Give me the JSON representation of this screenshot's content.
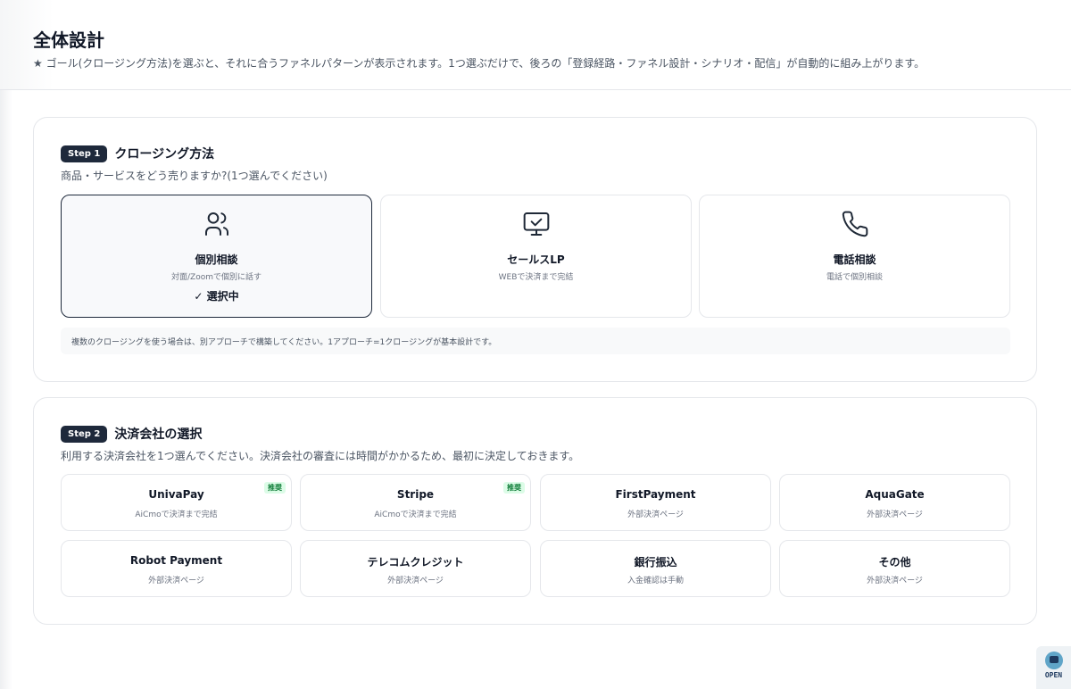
{
  "header": {
    "title": "全体設計",
    "subtitle": "★ ゴール(クロージング方法)を選ぶと、それに合うファネルパターンが表示されます。1つ選ぶだけで、後ろの「登録経路・ファネル設計・シナリオ・配信」が自動的に組み上がります。"
  },
  "step1": {
    "badge": "Step 1",
    "title": "クロージング方法",
    "description": "商品・サービスをどう売りますか?(1つ選んでください)",
    "options": [
      {
        "name": "個別相談",
        "sub": "対面/Zoomで個別に話す",
        "status": "✓ 選択中",
        "icon": "users-icon",
        "selected": true
      },
      {
        "name": "セールスLP",
        "sub": "WEBで決済まで完結",
        "icon": "monitor-check-icon"
      },
      {
        "name": "電話相談",
        "sub": "電話で個別相談",
        "icon": "phone-icon"
      }
    ],
    "note": "複数のクロージングを使う場合は、別アプローチで構築してください。1アプローチ=1クロージングが基本設計です。"
  },
  "step2": {
    "badge": "Step 2",
    "title": "決済会社の選択",
    "description": "利用する決済会社を1つ選んでください。決済会社の審査には時間がかかるため、最初に決定しておきます。",
    "providers": [
      {
        "name": "UnivaPay",
        "sub": "AiCmoで決済まで完結",
        "tag": "推奨"
      },
      {
        "name": "Stripe",
        "sub": "AiCmoで決済まで完結",
        "tag": "推奨"
      },
      {
        "name": "FirstPayment",
        "sub": "外部決済ページ"
      },
      {
        "name": "AquaGate",
        "sub": "外部決済ページ"
      },
      {
        "name": "Robot Payment",
        "sub": "外部決済ページ"
      },
      {
        "name": "テレコムクレジット",
        "sub": "外部決済ページ"
      },
      {
        "name": "銀行振込",
        "sub": "入金確認は手動"
      },
      {
        "name": "その他",
        "sub": "外部決済ページ"
      }
    ]
  },
  "badge": {
    "label": "OPEN"
  },
  "colors": {
    "primary": "#1e293b",
    "tag_bg": "#dcfce7",
    "tag_text": "#15803d"
  }
}
